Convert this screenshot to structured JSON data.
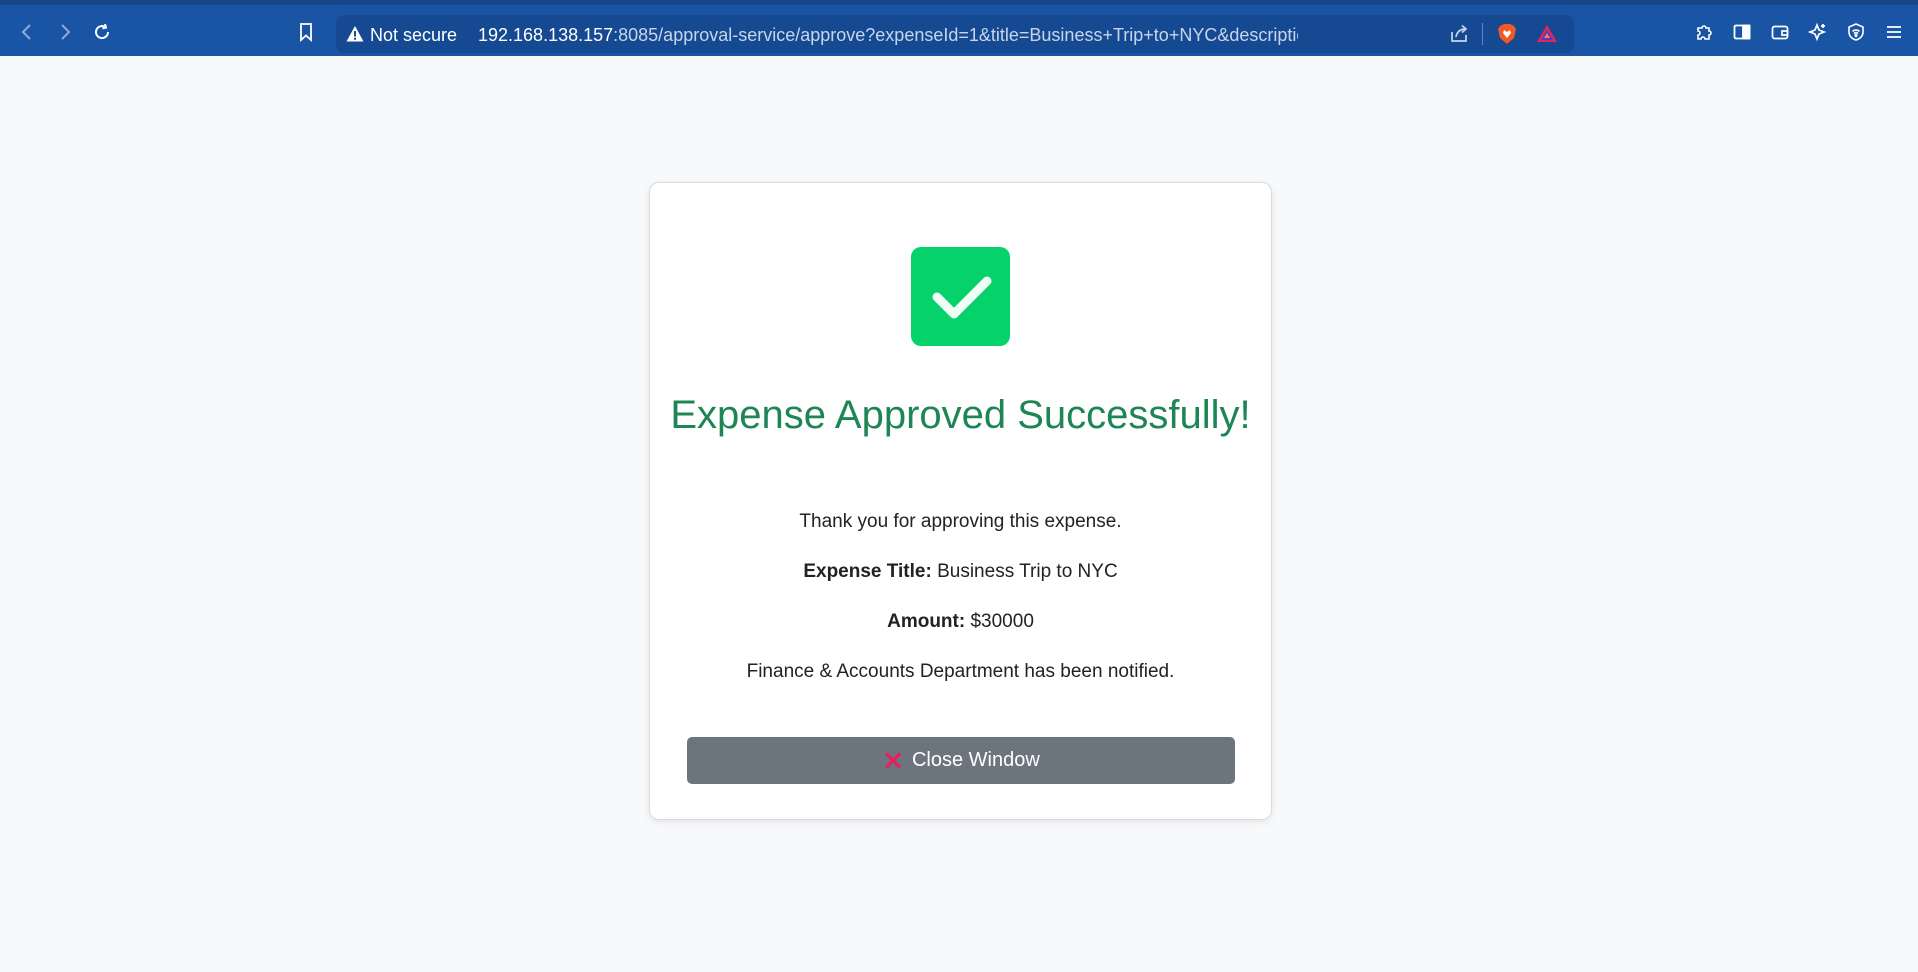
{
  "browser": {
    "security_label": "Not secure",
    "url_host": "192.168.138.157",
    "url_rest": ":8085/approval-service/approve?expenseId=1&title=Business+Trip+to+NYC&description=Flight+and+ac..."
  },
  "card": {
    "title": "Expense Approved Successfully!",
    "thanks": "Thank you for approving this expense.",
    "expense_title_label": "Expense Title:",
    "expense_title_value": "Business Trip to NYC",
    "amount_label": "Amount:",
    "amount_value": "$30000",
    "notified": "Finance & Accounts Department has been notified.",
    "close_button_label": "Close Window"
  },
  "colors": {
    "toolbar": "#1a55a5",
    "success_green": "#05d26b",
    "title_green": "#1e8554",
    "button_gray": "#6c757d"
  }
}
